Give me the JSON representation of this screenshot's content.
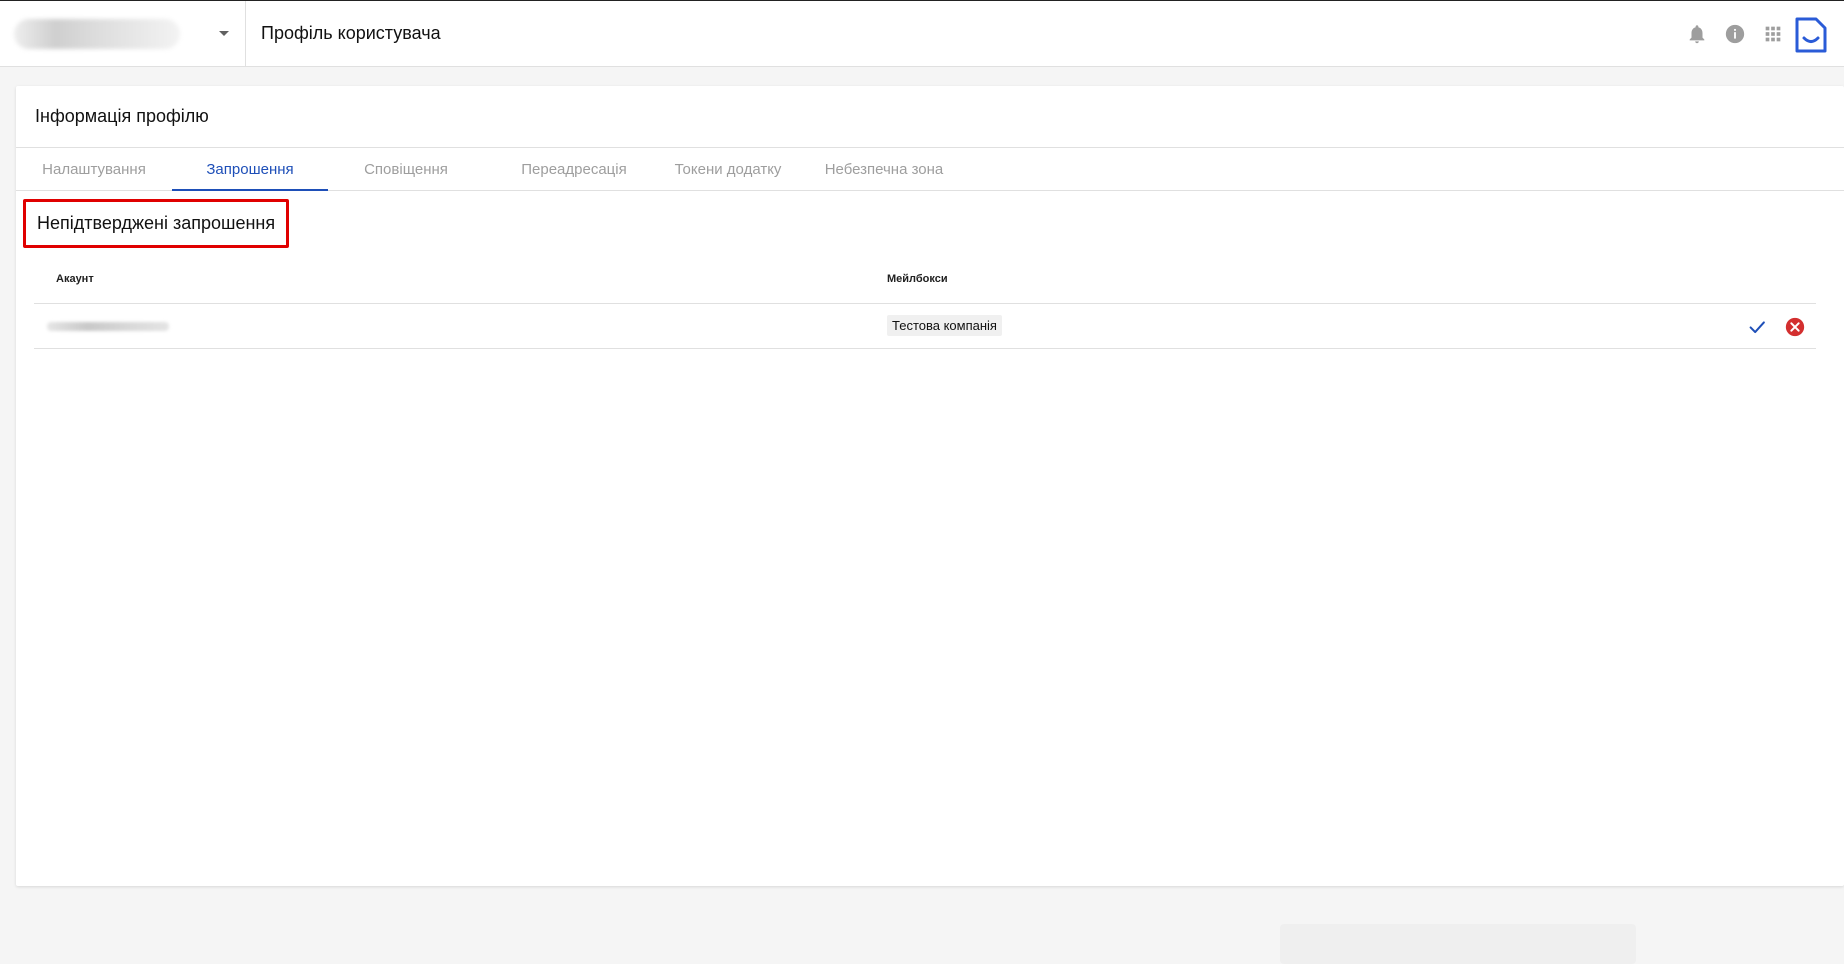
{
  "header": {
    "page_title": "Профіль користувача",
    "icons": [
      "bell-icon",
      "info-icon",
      "apps-grid-icon",
      "app-logo-icon"
    ]
  },
  "card": {
    "title": "Інформація профілю",
    "tabs": [
      {
        "label": "Налаштування",
        "active": false
      },
      {
        "label": "Запрошення",
        "active": true
      },
      {
        "label": "Сповіщення",
        "active": false
      },
      {
        "label": "Переадресація",
        "active": false
      },
      {
        "label": "Токени додатку",
        "active": false
      },
      {
        "label": "Небезпечна зона",
        "active": false
      }
    ]
  },
  "invitations": {
    "section_title": "Непідтверджені запрошення",
    "columns": {
      "account": "Акаунт",
      "mailboxes": "Мейлбокси"
    },
    "rows": [
      {
        "mailbox": "Тестова компанія"
      }
    ]
  },
  "colors": {
    "accent": "#1e4fb8",
    "danger": "#d32f2f",
    "highlight": "#e00000"
  }
}
